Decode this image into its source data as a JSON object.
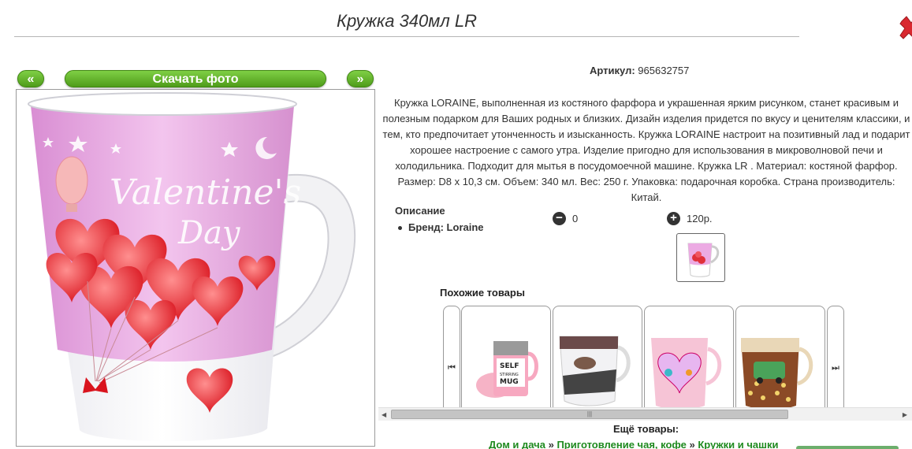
{
  "header": {
    "title": "Кружка 340мл LR"
  },
  "gallery": {
    "prev_label": "«",
    "download_label": "Скачать фото",
    "next_label": "»",
    "photo_text_line1": "Valentine's",
    "photo_text_line2": "Day"
  },
  "product": {
    "article_label": "Артикул:",
    "article_value": "965632757",
    "description": "Кружка LORAINE, выполненная из костяного фарфора и украшенная ярким рисунком, станет красивым и полезным подарком для Ваших родных и близких. Дизайн изделия придется по вкусу и ценителям классики, и тем, кто предпочитает утонченность и изысканность. Кружка LORAINE настроит на позитивный лад и подарит хорошее настроение с самого утра. Изделие пригодно для использования в микроволновой печи и холодильника. Подходит для мытья в посудомоечной машине. Кружка LR . Материал: костяной фарфор. Размер: D8 х 10,3 см. Объем: 340 мл. Вес: 250 г. Упаковка: подарочная коробка. Страна производитель: Китай.",
    "specs_heading": "Описание",
    "brand_text": "Бренд: Loraine",
    "minus_count": "0",
    "plus_price": "120р."
  },
  "similar": {
    "heading": "Похожие товары",
    "cards": [
      {
        "name": "self-stirring-mug",
        "text": "SELF STIRRING MUG"
      },
      {
        "name": "fashion-mug",
        "text": ""
      },
      {
        "name": "heart-mug",
        "text": ""
      },
      {
        "name": "car-mug",
        "text": ""
      }
    ]
  },
  "more": {
    "heading": "Ещё товары:",
    "crumbs": [
      "Дом и дача",
      "Приготовление чая, кофе",
      "Кружки и чашки"
    ],
    "sep": "»"
  },
  "colors": {
    "accent_green": "#5aa621",
    "link_green": "#1f8a1f",
    "close_red": "#d9282f"
  }
}
